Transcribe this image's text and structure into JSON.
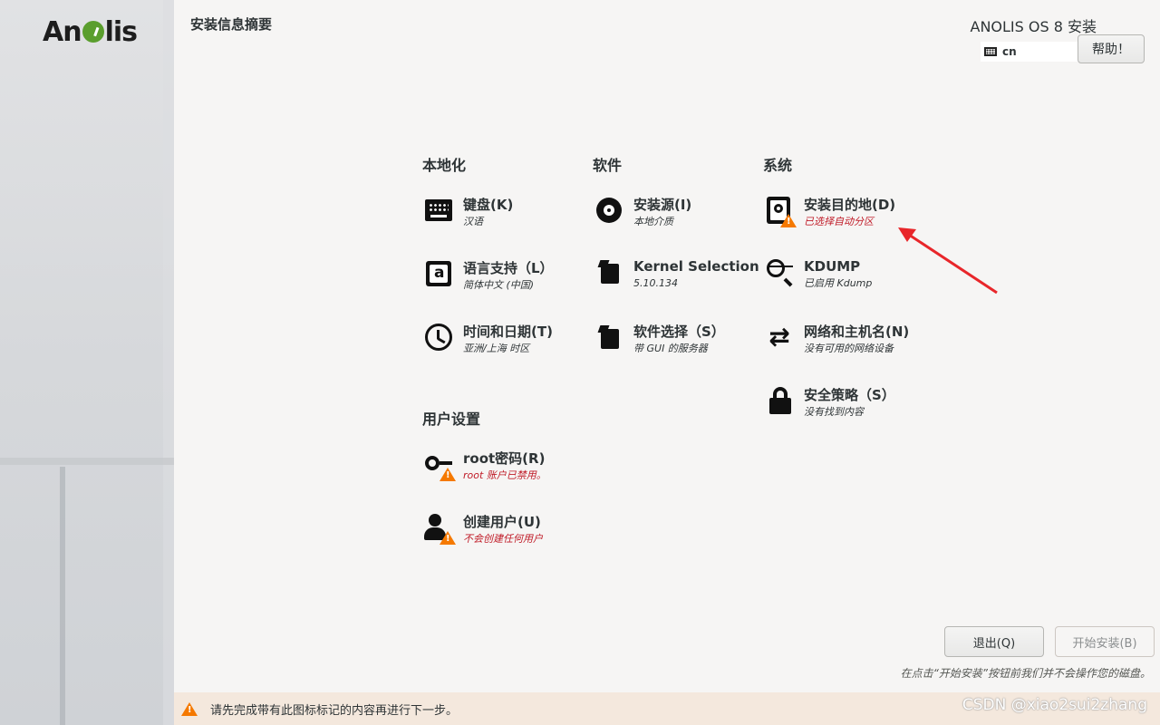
{
  "sidebar": {
    "logo_text": "Anolis",
    "accent_color": "#5a9e2d"
  },
  "header": {
    "page_title": "安装信息摘要",
    "product_title": "ANOLIS OS 8 安装",
    "keyboard_layout": "cn",
    "help_label": "帮助！"
  },
  "sections": {
    "localization": {
      "heading": "本地化",
      "items": [
        {
          "title": "键盘(K)",
          "status": "汉语",
          "icon": "keyboard-icon"
        },
        {
          "title": "语言支持（L）",
          "status": "简体中文 (中国)",
          "icon": "language-icon"
        },
        {
          "title": "时间和日期(T)",
          "status": "亚洲/上海 时区",
          "icon": "clock-icon"
        }
      ]
    },
    "software": {
      "heading": "软件",
      "items": [
        {
          "title": "安装源(I)",
          "status": "本地介质",
          "icon": "disc-icon"
        },
        {
          "title": "Kernel Selection",
          "status": "5.10.134",
          "icon": "package-icon"
        },
        {
          "title": "软件选择（S）",
          "status": "带 GUI 的服务器",
          "icon": "package-icon"
        }
      ]
    },
    "system": {
      "heading": "系统",
      "items": [
        {
          "title": "安装目的地(D)",
          "status": "已选择自动分区",
          "icon": "drive-icon",
          "warning": true
        },
        {
          "title": "KDUMP",
          "status": "已启用 Kdump",
          "icon": "kdump-search-icon"
        },
        {
          "title": "网络和主机名(N)",
          "status": "没有可用的网络设备",
          "icon": "network-arrows-icon"
        },
        {
          "title": "安全策略（S）",
          "status": "没有找到内容",
          "icon": "lock-icon"
        }
      ]
    },
    "user": {
      "heading": "用户设置",
      "items": [
        {
          "title": "root密码(R)",
          "status": "root 账户已禁用。",
          "icon": "key-icon",
          "warning": true
        },
        {
          "title": "创建用户(U)",
          "status": "不会创建任何用户",
          "icon": "user-icon",
          "warning": true
        }
      ]
    }
  },
  "footer": {
    "quit_label": "退出(Q)",
    "begin_label": "开始安装(B)",
    "note": "在点击“开始安装”按钮前我们并不会操作您的磁盘。",
    "warning_text": "请先完成带有此图标标记的内容再进行下一步。",
    "watermark": "CSDN @xiao2sui2zhang"
  },
  "colors": {
    "warning_orange": "#f57900",
    "warning_red": "#c01c28",
    "annotation_arrow": "#e8262a"
  }
}
